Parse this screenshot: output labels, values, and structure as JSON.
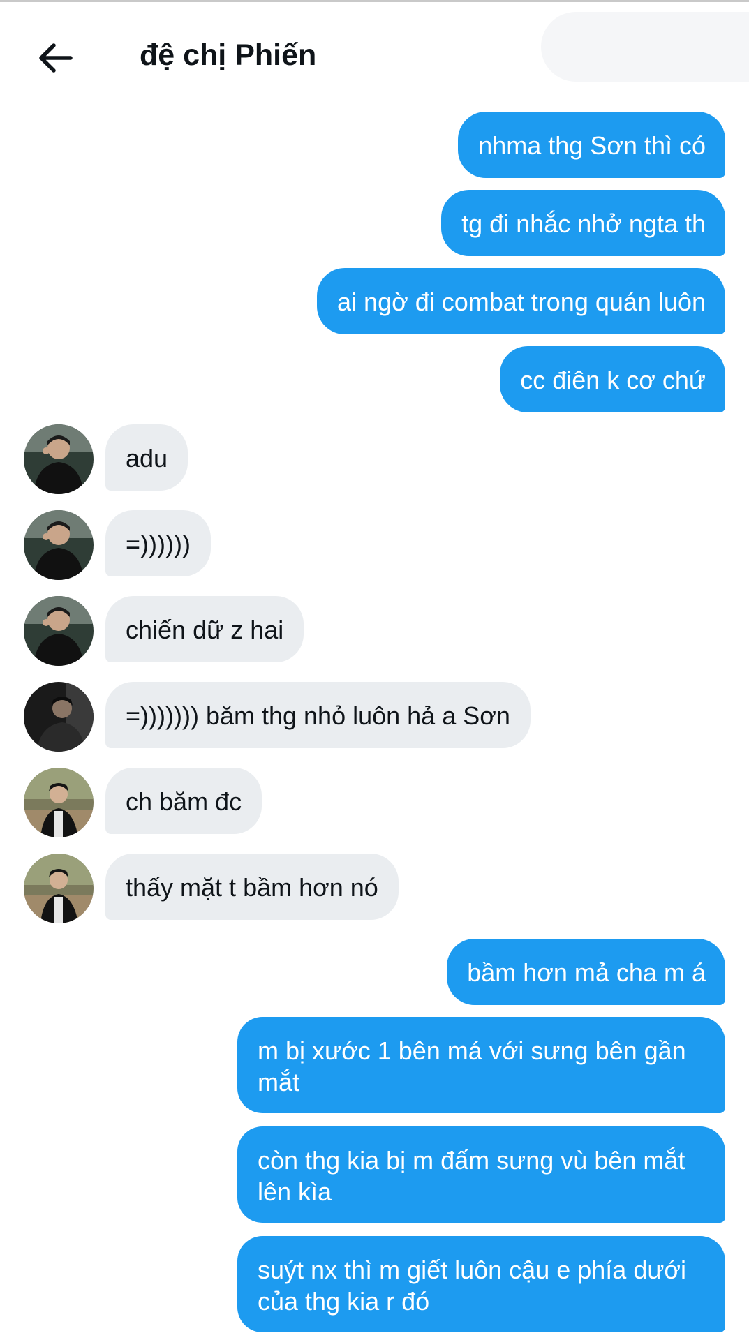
{
  "header": {
    "title": "đệ chị Phiến",
    "back_icon": "arrow-left-icon"
  },
  "colors": {
    "outgoing_bubble": "#1d9bf0",
    "incoming_bubble": "#eaedf0",
    "text_dark": "#0f1419"
  },
  "messages": [
    {
      "direction": "out",
      "text": "nhma thg Sơn thì có"
    },
    {
      "direction": "out",
      "text": "tg đi nhắc nhở ngta th"
    },
    {
      "direction": "out",
      "text": "ai ngờ đi combat trong quán luôn"
    },
    {
      "direction": "out",
      "text": "cc điên k cơ chứ"
    },
    {
      "direction": "in",
      "avatar": "avatar-a",
      "text": "adu"
    },
    {
      "direction": "in",
      "avatar": "avatar-a",
      "text": "=))))))"
    },
    {
      "direction": "in",
      "avatar": "avatar-a",
      "text": "chiến dữ z hai"
    },
    {
      "direction": "in",
      "avatar": "avatar-b",
      "text": "=))))))) băm thg nhỏ luôn hả a Sơn"
    },
    {
      "direction": "in",
      "avatar": "avatar-c",
      "text": "ch băm đc"
    },
    {
      "direction": "in",
      "avatar": "avatar-c",
      "text": "thấy mặt t bầm hơn nó"
    },
    {
      "direction": "out",
      "text": "bầm hơn mả cha m á"
    },
    {
      "direction": "out",
      "text": "m bị xước 1 bên má với sưng bên gần mắt"
    },
    {
      "direction": "out",
      "text": "còn thg kia bị m đấm sưng vù bên mắt lên kìa"
    },
    {
      "direction": "out",
      "text": "suýt nx thì m giết luôn cậu e phía dưới của thg kia r đó"
    }
  ]
}
